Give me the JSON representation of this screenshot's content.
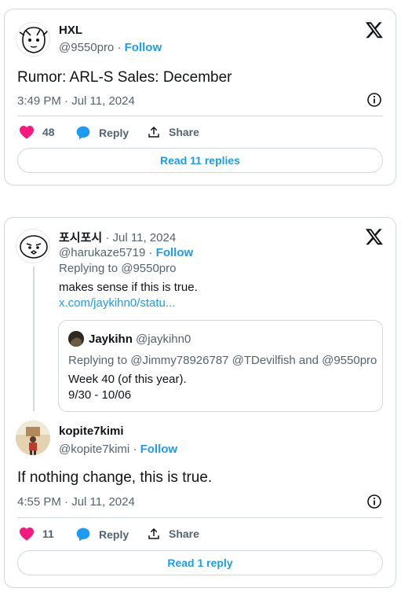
{
  "tweet1": {
    "name": "HXL",
    "handle": "@9550pro",
    "follow": "Follow",
    "text": "Rumor: ARL-S Sales: December",
    "timestamp": "3:49 PM · Jul 11, 2024",
    "likes": "48",
    "reply_label": "Reply",
    "share_label": "Share",
    "read_replies": "Read 11 replies"
  },
  "tweet2": {
    "name": "포시포시",
    "date": "· Jul 11, 2024",
    "handle": "@harukaze5719",
    "follow": "Follow",
    "replying_to": "Replying to @9550pro",
    "text": "makes sense if this is true.",
    "link": "x.com/jaykihn0/statu...",
    "quote": {
      "name": "Jaykihn",
      "handle": "@jaykihn0",
      "replying_to": "Replying to @Jimmy78926787 @TDevilfish and @9550pro",
      "line1": "Week 40 (of this year).",
      "line2": "9/30 - 10/06"
    }
  },
  "tweet3": {
    "name": "kopite7kimi",
    "handle": "@kopite7kimi",
    "follow": "Follow",
    "text": "If nothing change, this is true.",
    "timestamp": "4:55 PM · Jul 11, 2024",
    "likes": "11",
    "reply_label": "Reply",
    "share_label": "Share",
    "read_replies": "Read 1 reply"
  },
  "colors": {
    "accent": "#1d9bf0",
    "like": "#f91880",
    "secondary_text": "#536471",
    "border": "#cfd9de"
  },
  "icons": [
    "x-logo-icon",
    "info-icon",
    "heart-icon",
    "reply-bubble-icon",
    "share-icon"
  ]
}
